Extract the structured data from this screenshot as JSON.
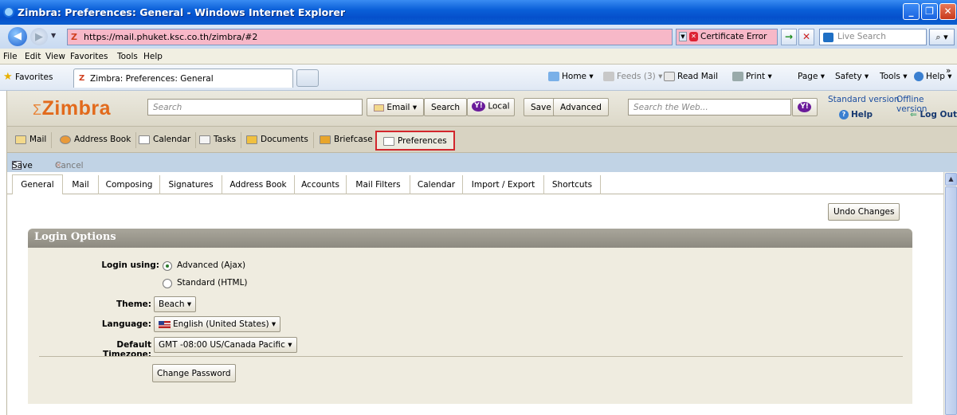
{
  "window": {
    "title": "Zimbra: Preferences: General - Windows Internet Explorer",
    "min": "_",
    "max": "❐",
    "close": "✕"
  },
  "address": {
    "url": "https://mail.phuket.ksc.co.th/zimbra/#2",
    "cert_error": "Certificate Error",
    "live_search_placeholder": "Live Search"
  },
  "menu": [
    "File",
    "Edit",
    "View",
    "Favorites",
    "Tools",
    "Help"
  ],
  "favbar": {
    "favorites": "Favorites",
    "tab_title": "Zimbra: Preferences: General",
    "commands": [
      "Home",
      "Feeds (3)",
      "Read Mail",
      "Print",
      "Page",
      "Safety",
      "Tools",
      "Help"
    ]
  },
  "zimbra": {
    "logo": "Zimbra",
    "search_placeholder": "Search",
    "email_btn": "Email",
    "search_btn": "Search",
    "local_btn": "Local",
    "save_btn": "Save",
    "advanced_btn": "Advanced",
    "web_search_placeholder": "Search the Web...",
    "standard_version": "Standard version",
    "offline_version": "Offline version",
    "help": "Help",
    "logout": "Log Out"
  },
  "app_tabs": [
    "Mail",
    "Address Book",
    "Calendar",
    "Tasks",
    "Documents",
    "Briefcase",
    "Preferences"
  ],
  "toolbar": {
    "save": "Save",
    "cancel": "Cancel"
  },
  "pref_tabs": [
    "General",
    "Mail",
    "Composing",
    "Signatures",
    "Address Book",
    "Accounts",
    "Mail Filters",
    "Calendar",
    "Import / Export",
    "Shortcuts"
  ],
  "content": {
    "undo": "Undo Changes",
    "section_title": "Login Options",
    "login_using_label": "Login using:",
    "login_options": [
      "Advanced (Ajax)",
      "Standard (HTML)"
    ],
    "login_selected": "Advanced (Ajax)",
    "theme_label": "Theme:",
    "theme_value": "Beach",
    "language_label": "Language:",
    "language_value": "English (United States)",
    "timezone_label": "Default Timezone:",
    "timezone_value": "GMT -08:00 US/Canada Pacific",
    "change_password": "Change Password"
  },
  "colors": {
    "titlebar": "#0a5fd8",
    "address_error_bg": "#f7b8c8",
    "zimbra_orange": "#e26a1c",
    "highlight_red": "#d2262c",
    "toolbar_blue": "#c1d3e5",
    "panel_bg": "#efece0"
  }
}
